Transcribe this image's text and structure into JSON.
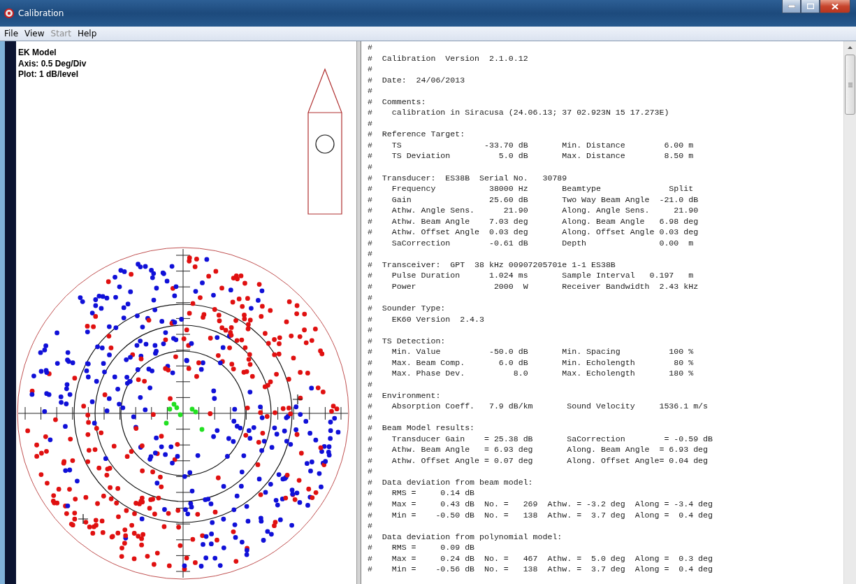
{
  "window": {
    "title": "Calibration"
  },
  "menu": [
    {
      "label": "File",
      "disabled": false
    },
    {
      "label": "View",
      "disabled": false
    },
    {
      "label": "Start",
      "disabled": true
    },
    {
      "label": "Help",
      "disabled": false
    }
  ],
  "plot_info": [
    "EK Model",
    "Axis: 0.5 Deg/Div",
    "Plot: 1 dB/level"
  ],
  "report": {
    "lines": [
      "#",
      "#  Calibration  Version  2.1.0.12",
      "#",
      "#  Date:  24/06/2013",
      "#",
      "#  Comments:",
      "#    calibration in Siracusa (24.06.13; 37 02.923N 15 17.273E)",
      "#",
      "#  Reference Target:",
      "#    TS                 -33.70 dB       Min. Distance        6.00 m",
      "#    TS Deviation          5.0 dB       Max. Distance        8.50 m",
      "#",
      "#  Transducer:  ES38B  Serial No.   30789",
      "#    Frequency           38000 Hz       Beamtype              Split",
      "#    Gain                25.60 dB       Two Way Beam Angle  -21.0 dB",
      "#    Athw. Angle Sens.      21.90       Along. Angle Sens.     21.90",
      "#    Athw. Beam Angle    7.03 deg       Along. Beam Angle   6.98 deg",
      "#    Athw. Offset Angle  0.03 deg       Along. Offset Angle 0.03 deg",
      "#    SaCorrection        -0.61 dB       Depth               0.00  m",
      "#",
      "#  Transceiver:  GPT  38 kHz 00907205701e 1-1 ES38B",
      "#    Pulse Duration      1.024 ms       Sample Interval   0.197   m",
      "#    Power                2000  W       Receiver Bandwidth  2.43 kHz",
      "#",
      "#  Sounder Type:",
      "#    EK60 Version  2.4.3",
      "#",
      "#  TS Detection:",
      "#    Min. Value          -50.0 dB       Min. Spacing          100 %",
      "#    Max. Beam Comp.       6.0 dB       Min. Echolength        80 %",
      "#    Max. Phase Dev.          8.0       Max. Echolength       180 %",
      "#",
      "#  Environment:",
      "#    Absorption Coeff.   7.9 dB/km       Sound Velocity     1536.1 m/s",
      "#",
      "#  Beam Model results:",
      "#    Transducer Gain    = 25.38 dB       SaCorrection        = -0.59 dB",
      "#    Athw. Beam Angle   = 6.93 deg       Along. Beam Angle  = 6.93 deg",
      "#    Athw. Offset Angle = 0.07 deg       Along. Offset Angle= 0.04 deg",
      "#",
      "#  Data deviation from beam model:",
      "#    RMS =     0.14 dB",
      "#    Max =     0.43 dB  No. =   269  Athw. = -3.2 deg  Along = -3.4 deg",
      "#    Min =    -0.50 dB  No. =   138  Athw. =  3.7 deg  Along =  0.4 deg",
      "#",
      "#  Data deviation from polynomial model:",
      "#    RMS =     0.09 dB",
      "#    Max =     0.24 dB  No. =   467  Athw. =  5.0 deg  Along =  0.3 deg",
      "#    Min =    -0.56 dB  No. =   138  Athw. =  3.7 deg  Along =  0.4 deg"
    ]
  }
}
